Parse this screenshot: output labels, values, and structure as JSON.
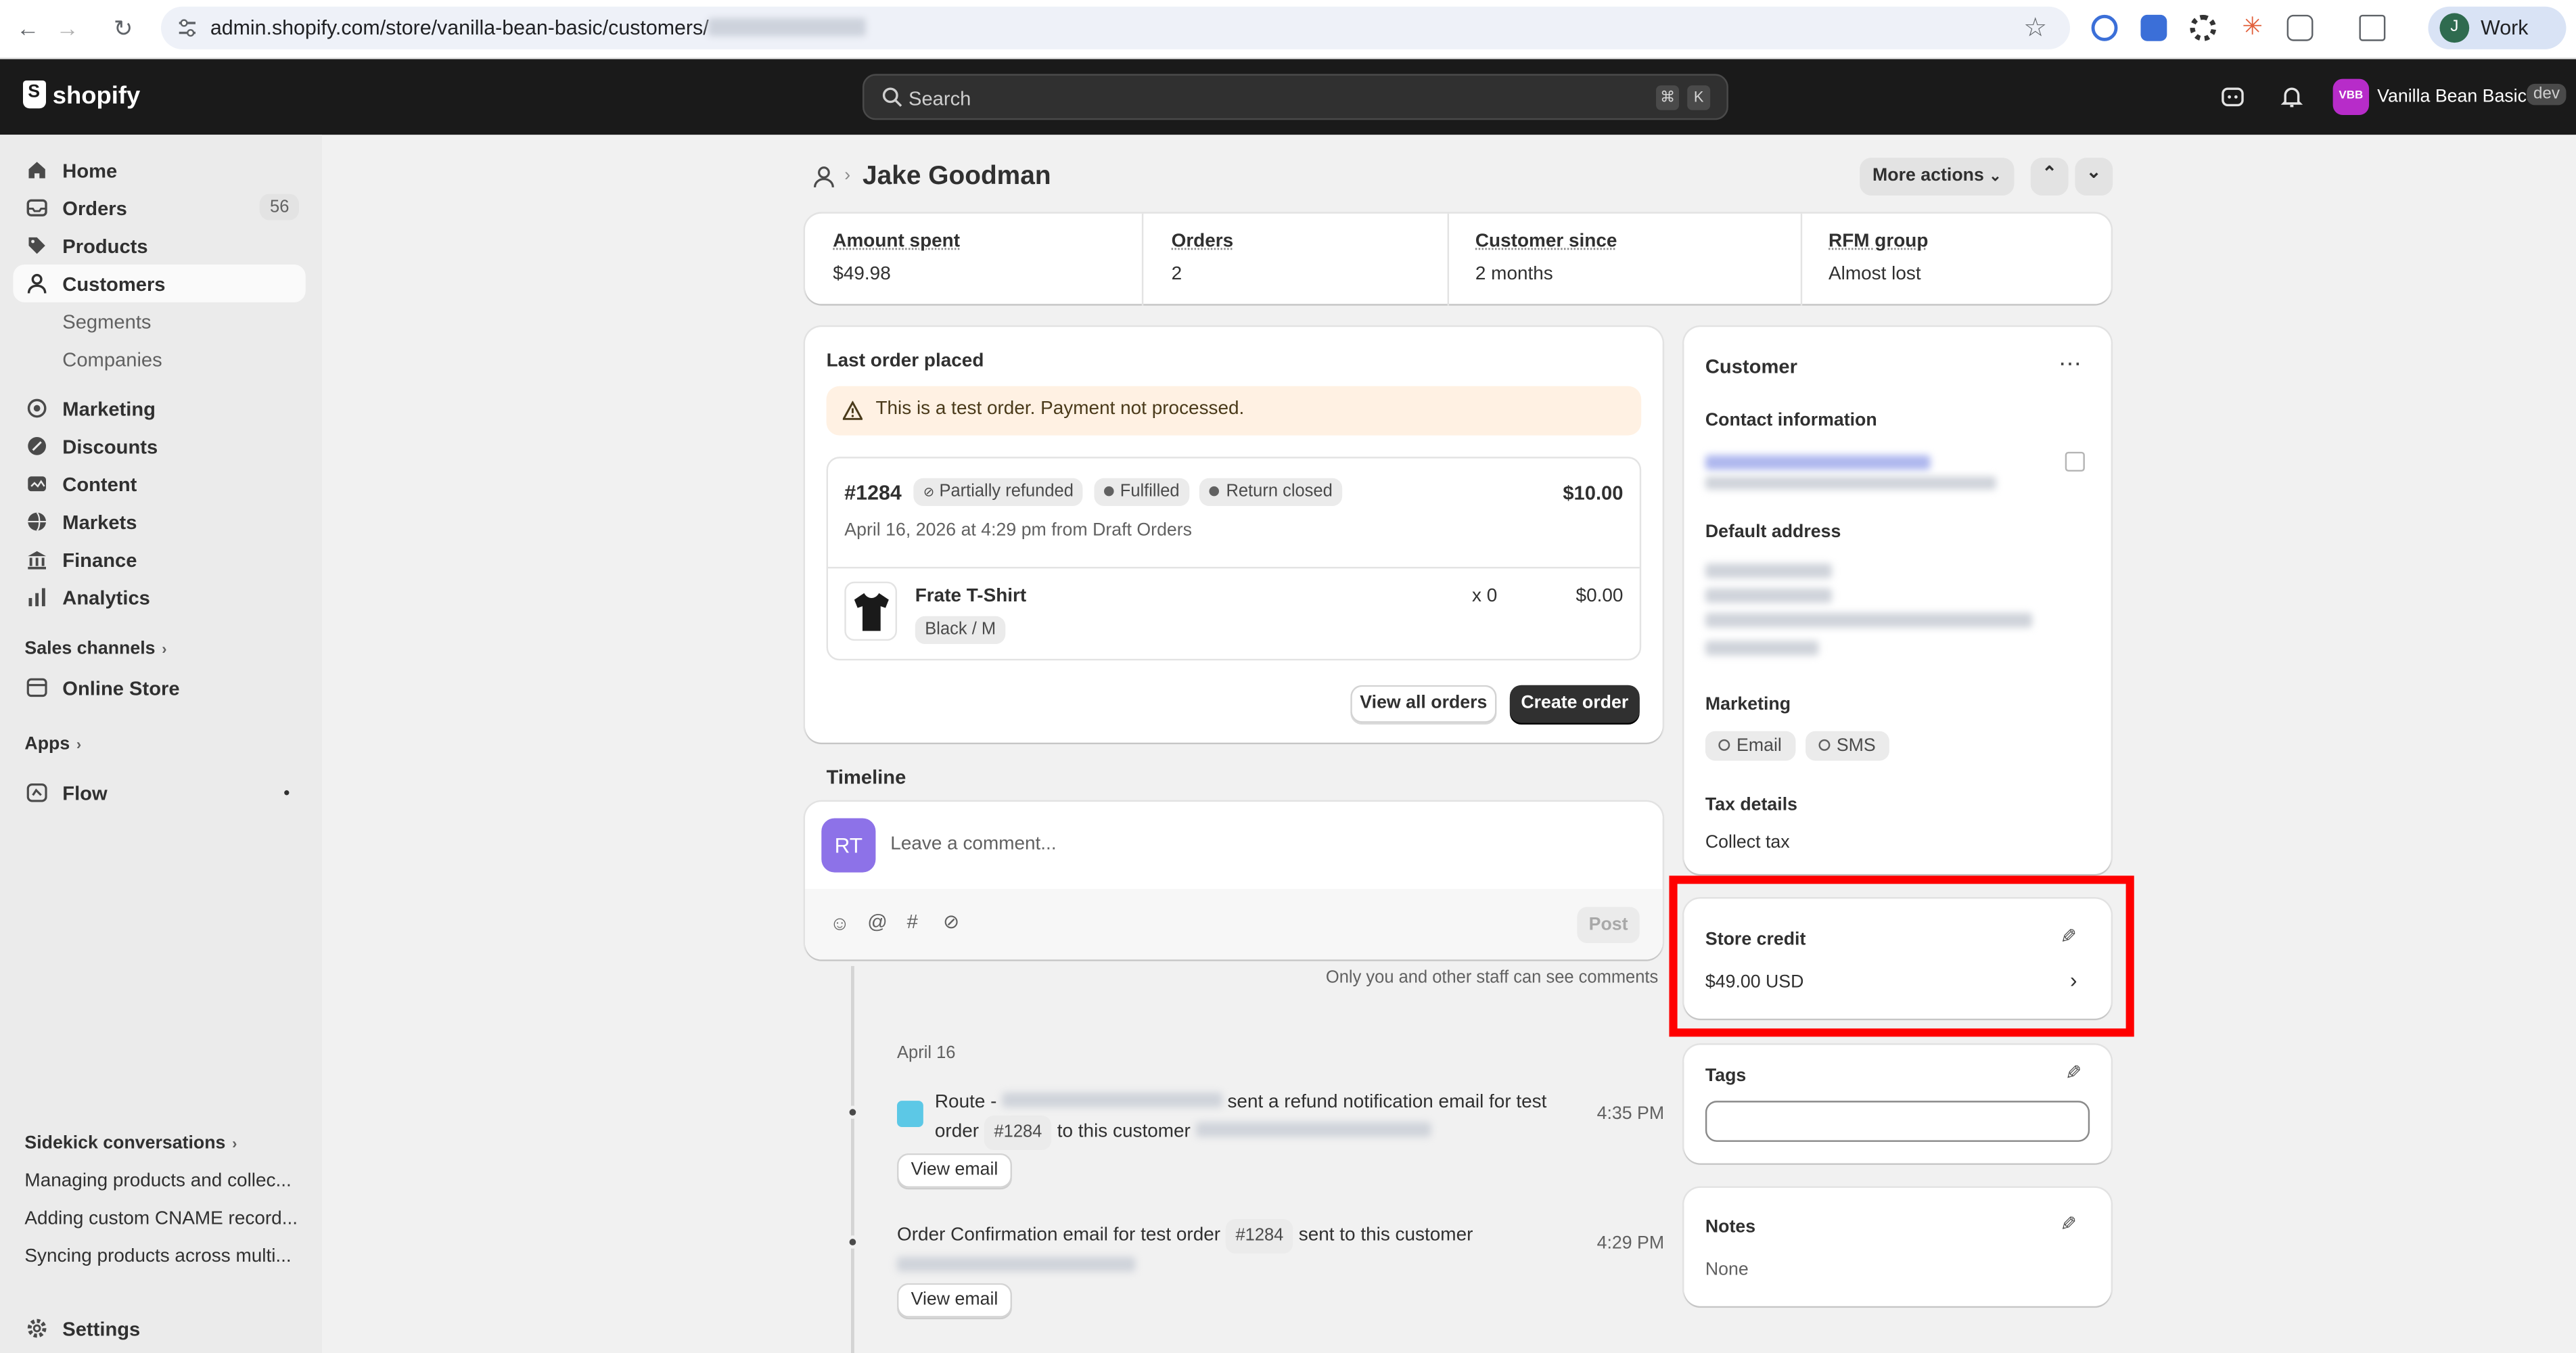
{
  "browser": {
    "url_prefix": "admin.shopify.com/store/vanilla-bean-basic/customers/",
    "profile_initial": "J",
    "profile_label": "Work"
  },
  "topbar": {
    "brand": "shopify",
    "search_placeholder": "Search",
    "shortcut_key1": "⌘",
    "shortcut_key2": "K",
    "store_initials": "VBB",
    "store_name": "Vanilla Bean Basic",
    "store_badge": "dev"
  },
  "sidebar": {
    "items": [
      {
        "label": "Home",
        "icon": "home-icon"
      },
      {
        "label": "Orders",
        "icon": "inbox-icon",
        "count": "56"
      },
      {
        "label": "Products",
        "icon": "tag-icon"
      },
      {
        "label": "Customers",
        "icon": "person-icon"
      },
      {
        "label": "Segments"
      },
      {
        "label": "Companies"
      },
      {
        "label": "Marketing",
        "icon": "target-icon"
      },
      {
        "label": "Discounts",
        "icon": "discount-icon"
      },
      {
        "label": "Content",
        "icon": "content-icon"
      },
      {
        "label": "Markets",
        "icon": "globe-icon"
      },
      {
        "label": "Finance",
        "icon": "bank-icon"
      },
      {
        "label": "Analytics",
        "icon": "chart-icon"
      }
    ],
    "sales_channels": "Sales channels",
    "online_store": "Online Store",
    "apps": "Apps",
    "flow": "Flow",
    "sidekick_heading": "Sidekick conversations",
    "conversations": [
      "Managing products and collec...",
      "Adding custom CNAME record...",
      "Syncing products across multi..."
    ],
    "settings": "Settings"
  },
  "header": {
    "title": "Jake Goodman",
    "more_actions": "More actions"
  },
  "stats": [
    {
      "label": "Amount spent",
      "value": "$49.98"
    },
    {
      "label": "Orders",
      "value": "2"
    },
    {
      "label": "Customer since",
      "value": "2 months"
    },
    {
      "label": "RFM group",
      "value": "Almost lost"
    }
  ],
  "last_order": {
    "heading": "Last order placed",
    "warning": "This is a test order. Payment not processed.",
    "number": "#1284",
    "badges": [
      "Partially refunded",
      "Fulfilled",
      "Return closed"
    ],
    "total": "$10.00",
    "date_line": "April 16, 2026 at 4:29 pm from Draft Orders",
    "item_name": "Frate T-Shirt",
    "item_variant": "Black / M",
    "item_qty": "x 0",
    "item_price": "$0.00",
    "view_all": "View all orders",
    "create": "Create order"
  },
  "timeline": {
    "heading": "Timeline",
    "avatar": "RT",
    "comment_placeholder": "Leave a comment...",
    "post": "Post",
    "privacy_note": "Only you and other staff can see comments",
    "date": "April 16",
    "event1_prefix": "Route -",
    "event1_text": "sent a refund notification email for test",
    "event1_order_word": "order",
    "event1_order": "#1284",
    "event1_suffix": "to this customer",
    "event1_time": "4:35 PM",
    "view_email": "View email",
    "event2_text": "Order Confirmation email for test order",
    "event2_order": "#1284",
    "event2_suffix": "sent to this customer",
    "event2_time": "4:29 PM"
  },
  "customer_card": {
    "heading": "Customer",
    "contact_heading": "Contact information",
    "default_address": "Default address",
    "marketing": "Marketing",
    "marketing_email": "Email",
    "marketing_sms": "SMS",
    "tax_heading": "Tax details",
    "tax_value": "Collect tax"
  },
  "store_credit": {
    "heading": "Store credit",
    "value": "$49.00 USD"
  },
  "tags": {
    "heading": "Tags",
    "value": ""
  },
  "notes": {
    "heading": "Notes",
    "value": "None"
  },
  "highlight_color": "#ff0000"
}
